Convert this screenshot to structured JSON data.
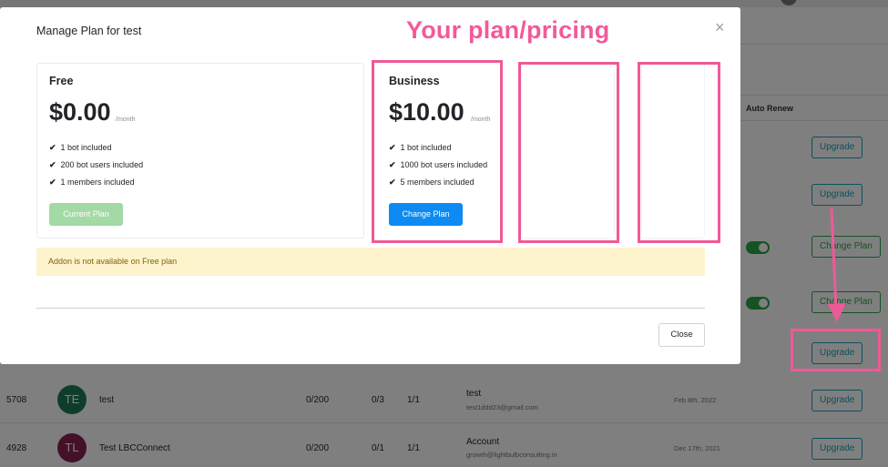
{
  "modal": {
    "title": "Manage Plan for test",
    "close_icon": "×",
    "plans": [
      {
        "name": "Free",
        "price": "$0.00",
        "period": "/month",
        "features": [
          "1 bot included",
          "200 bot users included",
          "1 members included"
        ],
        "button_label": "Current Plan"
      },
      {
        "name": "Business",
        "price": "$10.00",
        "period": "/month",
        "features": [
          "1 bot included",
          "1000 bot users included",
          "5 members included"
        ],
        "button_label": "Change Plan"
      }
    ],
    "check_icon": "✔",
    "addon_alert": "Addon is not available on Free plan",
    "close_button": "Close"
  },
  "annotation": {
    "title": "Your plan/pricing",
    "color": "#ee5a97"
  },
  "background": {
    "auto_renew_header": "Auto Renew",
    "action_buttons": [
      "Upgrade",
      "Upgrade",
      "Change Plan",
      "Change Plan",
      "Upgrade",
      "Upgrade",
      "Upgrade"
    ],
    "rows": [
      {
        "id": "5708",
        "initials": "TE",
        "avatar_color": "#1e7b57",
        "name": "test",
        "bot_users": "0/200",
        "members": "0/3",
        "bots": "1/1",
        "plan_name": "test",
        "email": "test1ddd23@gmail.com",
        "date": "Feb 8th, 2022"
      },
      {
        "id": "4928",
        "initials": "TL",
        "avatar_color": "#8b2252",
        "name": "Test LBCConnect",
        "bot_users": "0/200",
        "members": "0/1",
        "bots": "1/1",
        "plan_name": "Account",
        "email": "growth@lightbulbconsulting.in",
        "date": "Dec 17th, 2021"
      }
    ]
  },
  "colors": {
    "primary": "#0d8bf2",
    "success_light": "#a3d9a5",
    "alert_bg": "#fdf3cd",
    "alert_text": "#856404"
  }
}
